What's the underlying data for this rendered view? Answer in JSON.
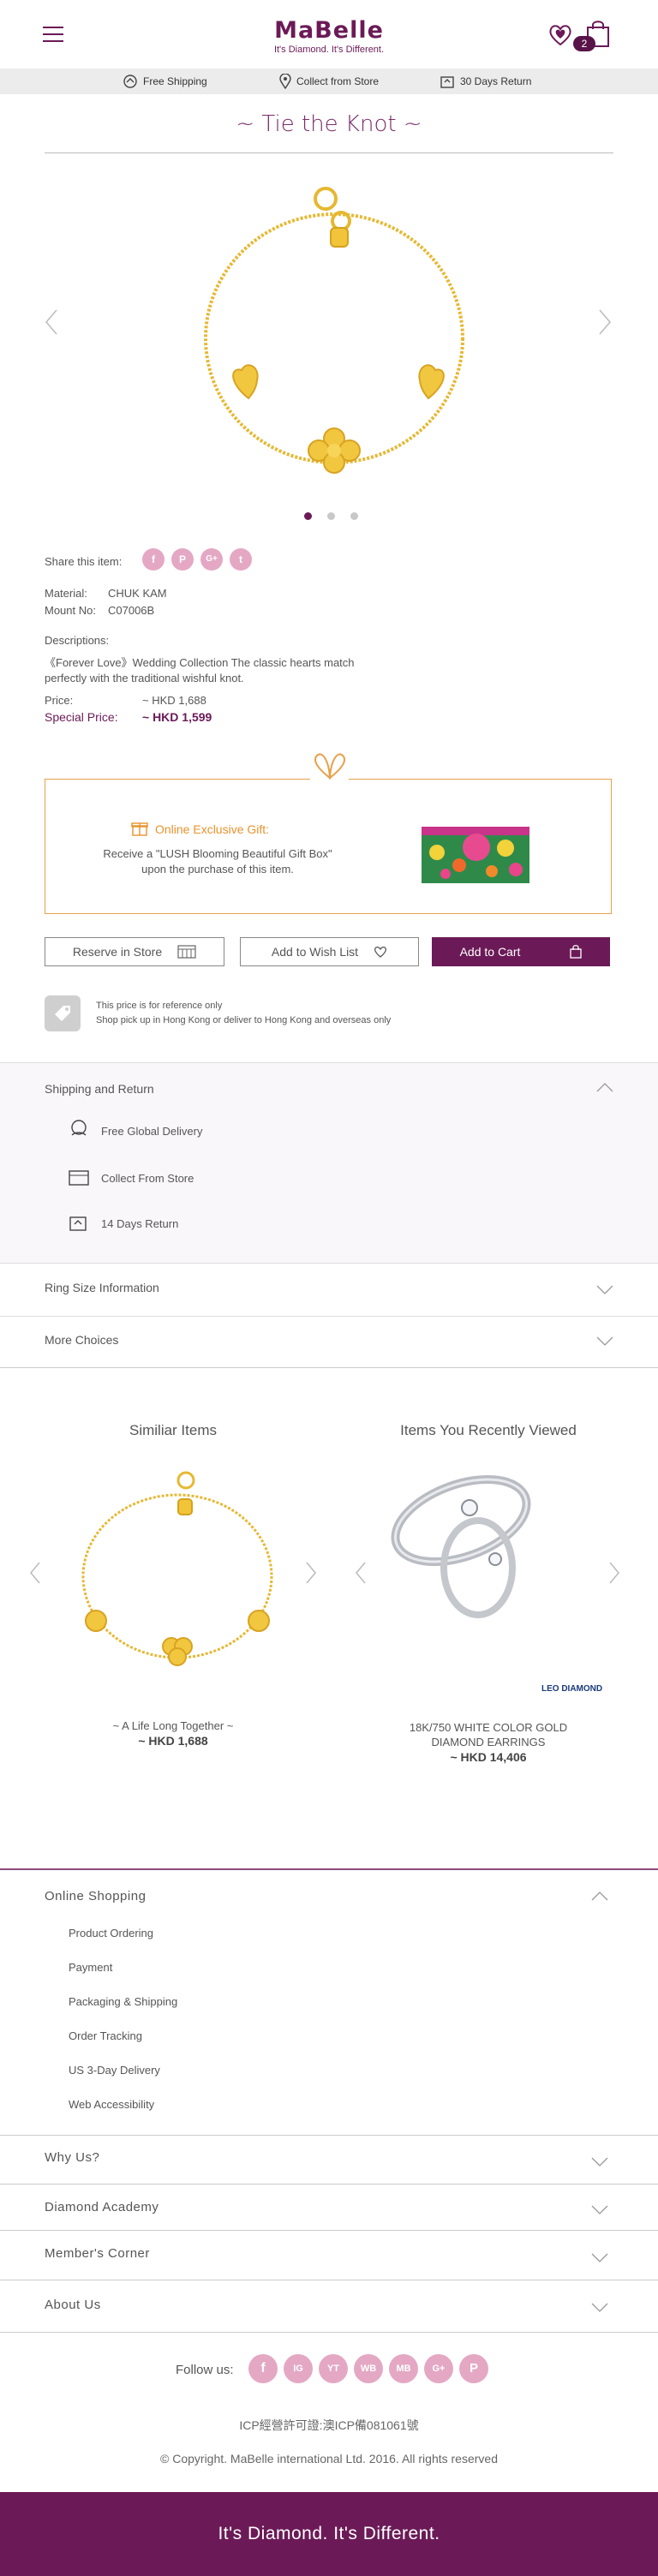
{
  "header": {
    "logo": "MaBelle",
    "tagline": "It's Diamond. It's Different.",
    "cart_count": "2",
    "menu_icon": "hamburger-menu-icon",
    "wishlist_icon": "heart-icon",
    "cart_icon": "shopping-bag-icon"
  },
  "service_bar": [
    {
      "label": "Free Shipping",
      "icon": "delivery-hand-icon"
    },
    {
      "label": "Collect from Store",
      "icon": "location-pin-icon"
    },
    {
      "label": "30 Days Return",
      "icon": "return-box-icon"
    }
  ],
  "product": {
    "title": "~ Tie the Knot ~",
    "share_label": "Share this item:",
    "material_label": "Material:",
    "material_value": "CHUK KAM",
    "mount_label": "Mount No:",
    "mount_value": "C07006B",
    "descriptions_label": "Descriptions:",
    "description": "《Forever Love》Wedding Collection The classic hearts match perfectly with the traditional wishful knot.",
    "price_label": "Price:",
    "price_value": "~ HKD 1,688",
    "special_label": "Special Price:",
    "special_value": "~ HKD 1,599",
    "carousel_slides": 3,
    "active_slide": 1
  },
  "gift": {
    "title": "Online Exclusive Gift:",
    "description": "Receive a \"LUSH Blooming Beautiful Gift Box\" upon the purchase of this item."
  },
  "actions": {
    "reserve": "Reserve in Store",
    "wishlist": "Add to Wish List",
    "add_to_cart": "Add to Cart"
  },
  "notes": {
    "line1": "This price is for reference only",
    "line2": "Shop pick up in Hong Kong or deliver to Hong Kong and overseas only"
  },
  "shipping_section": {
    "title": "Shipping and Return",
    "items": [
      "Free Global Delivery",
      "Collect From Store",
      "14 Days Return"
    ]
  },
  "accordions": {
    "ring_size": "Ring Size Information",
    "more_choices": "More Choices"
  },
  "similar": {
    "title": "Similiar Items",
    "name": "~ A Life Long Together ~",
    "price": "~ HKD 1,688"
  },
  "recent": {
    "title": "Items You Recently Viewed",
    "name": "18K/750 WHITE COLOR GOLD DIAMOND EARRINGS",
    "price": "~ HKD 14,406",
    "brand": "LEO DIAMOND"
  },
  "footer": {
    "online_shopping": "Online Shopping",
    "links": [
      "Product Ordering",
      "Payment",
      "Packaging & Shipping",
      "Order Tracking",
      "US 3-Day Delivery",
      "Web Accessibility"
    ],
    "why_us": "Why Us?",
    "diamond_academy": "Diamond Academy",
    "members_corner": "Member's Corner",
    "about_us": "About Us",
    "follow_us": "Follow us:",
    "social": [
      "facebook-icon",
      "instagram-icon",
      "youtube-icon",
      "weibo-icon",
      "mabelle-app-icon",
      "google-plus-icon",
      "pinterest-icon"
    ],
    "icp": "ICP經營許可證:澳ICP備081061號",
    "copyright": "© Copyright. MaBelle international Ltd.  2016.  All rights reserved",
    "tagline": "It's Diamond. It's Different."
  },
  "colors": {
    "brand": "#6b1a57",
    "gift_accent": "#e8a14a",
    "social": "#e4a8c4"
  }
}
